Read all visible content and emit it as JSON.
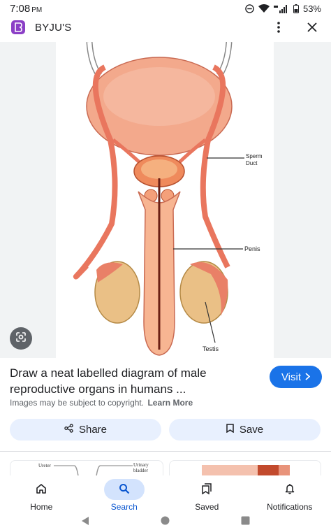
{
  "status_bar": {
    "time": "7:08",
    "time_suffix": "PM",
    "battery": "53%"
  },
  "header": {
    "app_name": "BYJU'S"
  },
  "diagram": {
    "labels": {
      "sperm_duct_line1": "Sperm",
      "sperm_duct_line2": "Duct",
      "penis": "Penis",
      "testis": "Testis"
    },
    "thumb1_labels": {
      "ureter": "Ureter",
      "urinary1": "Urinary",
      "urinary2": "bladder"
    }
  },
  "result": {
    "title": "Draw a neat labelled diagram of male reproductive organs in humans ...",
    "visit_label": "Visit",
    "copyright": "Images may be subject to copyright.",
    "learn_more": "Learn More"
  },
  "actions": {
    "share_label": "Share",
    "save_label": "Save"
  },
  "bottom_nav": {
    "home": "Home",
    "search": "Search",
    "saved": "Saved",
    "notifications": "Notifications"
  },
  "colors": {
    "accent": "#1a73e8",
    "brand": "#8b3fc6",
    "chip_bg": "#e8f0fe",
    "nav_active": "#d3e3fd"
  }
}
